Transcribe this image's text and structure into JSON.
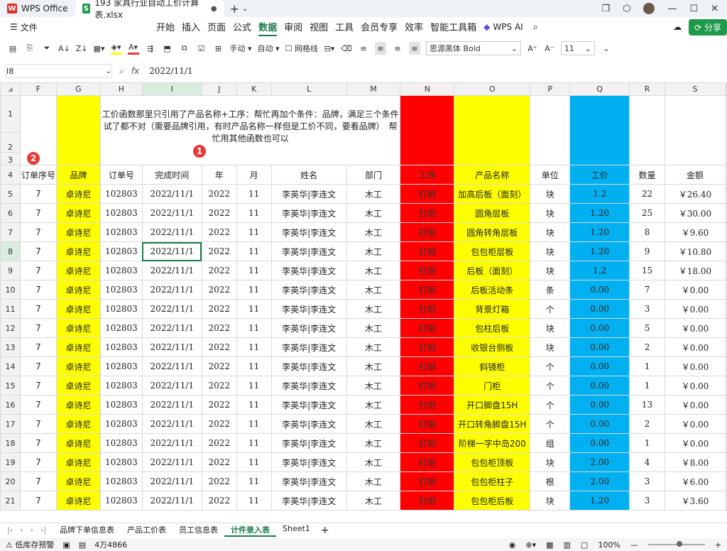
{
  "titlebar": {
    "app_name": "WPS Office",
    "doc_name": "193 家具行业自动工价计算表.xlsx"
  },
  "menu": {
    "file": "文件",
    "items": [
      "开始",
      "插入",
      "页面",
      "公式",
      "数据",
      "审阅",
      "视图",
      "工具",
      "会员专享",
      "效率",
      "智能工具箱"
    ],
    "active": "数据",
    "wps_ai": "WPS AI",
    "share": "分享"
  },
  "toolbar": {
    "manual": "手动",
    "auto": "自动",
    "gridlines": "网格线",
    "font": "思源黑体 Bold",
    "size": "11"
  },
  "formulabar": {
    "cell_ref": "I8",
    "formula": "2022/11/1"
  },
  "columns": [
    "F",
    "G",
    "H",
    "I",
    "J",
    "K",
    "L",
    "M",
    "N",
    "O",
    "P",
    "Q",
    "R",
    "S"
  ],
  "note": "工价函数那里只引用了产品名称+工序：帮忙再加个条件：品牌，满足三个条件试了都不对（需要品牌引用，有时产品名称一样但是工价不同，要看品牌）　帮忙用其他函数也可以",
  "badges": [
    "1",
    "2"
  ],
  "header_row": {
    "row": "4",
    "cells": [
      "订单序号",
      "品牌",
      "订单号",
      "完成时间",
      "年",
      "月",
      "姓名",
      "部门",
      "工序",
      "产品名称",
      "单位",
      "工价",
      "数量",
      "金额"
    ]
  },
  "rows": [
    {
      "row": "5",
      "cells": [
        "7",
        "卓诗尼",
        "102803",
        "2022/11/1",
        "2022",
        "11",
        "李英华|李连文",
        "木工",
        "打眼",
        "加高后板（面刻）",
        "块",
        "1.2",
        "22",
        "￥26.40"
      ]
    },
    {
      "row": "6",
      "cells": [
        "7",
        "卓诗尼",
        "102803",
        "2022/11/1",
        "2022",
        "11",
        "李英华|李连文",
        "木工",
        "打眼",
        "圆角层板",
        "块",
        "1.20",
        "25",
        "￥30.00"
      ]
    },
    {
      "row": "7",
      "cells": [
        "7",
        "卓诗尼",
        "102803",
        "2022/11/1",
        "2022",
        "11",
        "李英华|李连文",
        "木工",
        "打眼",
        "圆角转角层板",
        "块",
        "1.20",
        "8",
        "￥9.60"
      ]
    },
    {
      "row": "8",
      "cells": [
        "7",
        "卓诗尼",
        "102803",
        "2022/11/1",
        "2022",
        "11",
        "李英华|李连文",
        "木工",
        "打眼",
        "包包柜层板",
        "块",
        "1.20",
        "9",
        "￥10.80"
      ]
    },
    {
      "row": "9",
      "cells": [
        "7",
        "卓诗尼",
        "102803",
        "2022/11/1",
        "2022",
        "11",
        "李英华|李连文",
        "木工",
        "打眼",
        "后板（面刻）",
        "块",
        "1.2",
        "15",
        "￥18.00"
      ]
    },
    {
      "row": "10",
      "cells": [
        "7",
        "卓诗尼",
        "102803",
        "2022/11/1",
        "2022",
        "11",
        "李英华|李连文",
        "木工",
        "打眼",
        "后板活动条",
        "条",
        "0.00",
        "7",
        "￥0.00"
      ]
    },
    {
      "row": "11",
      "cells": [
        "7",
        "卓诗尼",
        "102803",
        "2022/11/1",
        "2022",
        "11",
        "李英华|李连文",
        "木工",
        "打眼",
        "背景灯箱",
        "个",
        "0.00",
        "3",
        "￥0.00"
      ]
    },
    {
      "row": "12",
      "cells": [
        "7",
        "卓诗尼",
        "102803",
        "2022/11/1",
        "2022",
        "11",
        "李英华|李连文",
        "木工",
        "打眼",
        "包柱后板",
        "块",
        "0.00",
        "5",
        "￥0.00"
      ]
    },
    {
      "row": "13",
      "cells": [
        "7",
        "卓诗尼",
        "102803",
        "2022/11/1",
        "2022",
        "11",
        "李英华|李连文",
        "木工",
        "打眼",
        "收银台侧板",
        "块",
        "0.00",
        "2",
        "￥0.00"
      ]
    },
    {
      "row": "14",
      "cells": [
        "7",
        "卓诗尼",
        "102803",
        "2022/11/1",
        "2022",
        "11",
        "李英华|李连文",
        "木工",
        "打眼",
        "斜镜柜",
        "个",
        "0.00",
        "1",
        "￥0.00"
      ]
    },
    {
      "row": "15",
      "cells": [
        "7",
        "卓诗尼",
        "102803",
        "2022/11/1",
        "2022",
        "11",
        "李英华|李连文",
        "木工",
        "打眼",
        "门柜",
        "个",
        "0.00",
        "1",
        "￥0.00"
      ]
    },
    {
      "row": "16",
      "cells": [
        "7",
        "卓诗尼",
        "102803",
        "2022/11/1",
        "2022",
        "11",
        "李英华|李连文",
        "木工",
        "打眼",
        "开口脚盘15H",
        "个",
        "0.00",
        "13",
        "￥0.00"
      ]
    },
    {
      "row": "17",
      "cells": [
        "7",
        "卓诗尼",
        "102803",
        "2022/11/1",
        "2022",
        "11",
        "李英华|李连文",
        "木工",
        "打眼",
        "开口转角脚盘15H",
        "个",
        "0.00",
        "2",
        "￥0.00"
      ]
    },
    {
      "row": "18",
      "cells": [
        "7",
        "卓诗尼",
        "102803",
        "2022/11/1",
        "2022",
        "11",
        "李英华|李连文",
        "木工",
        "打眼",
        "阶梯一字中岛200",
        "组",
        "0.00",
        "1",
        "￥0.00"
      ]
    },
    {
      "row": "19",
      "cells": [
        "7",
        "卓诗尼",
        "102803",
        "2022/11/1",
        "2022",
        "11",
        "李英华|李连文",
        "木工",
        "打眼",
        "包包柜顶板",
        "块",
        "2.00",
        "4",
        "￥8.00"
      ]
    },
    {
      "row": "20",
      "cells": [
        "7",
        "卓诗尼",
        "102803",
        "2022/11/1",
        "2022",
        "11",
        "李英华|李连文",
        "木工",
        "打眼",
        "包包柜柱子",
        "根",
        "2.00",
        "3",
        "￥6.00"
      ]
    },
    {
      "row": "21",
      "cells": [
        "7",
        "卓诗尼",
        "102803",
        "2022/11/1",
        "2022",
        "11",
        "李英华|李连文",
        "木工",
        "打眼",
        "包包柜后板",
        "块",
        "1.20",
        "3",
        "￥3.60"
      ]
    }
  ],
  "sheet_tabs": [
    "品牌下单信息表",
    "产品工价表",
    "员工信息表",
    "计件录入表",
    "Sheet1"
  ],
  "active_sheet": "计件录入表",
  "status": {
    "warning": "低库存预警",
    "count": "4万4866",
    "zoom": "100%"
  },
  "colors": {
    "brand_green": "#1c7a49",
    "yellow": "#ffff00",
    "red": "#ff0000",
    "blue": "#00b0f0"
  }
}
